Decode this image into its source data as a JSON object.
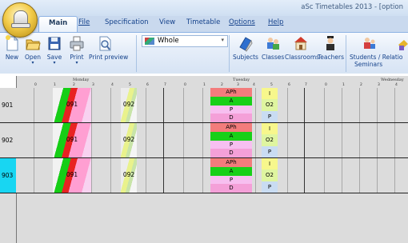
{
  "window": {
    "title": "aSc Timetables 2013 - [option"
  },
  "menu_tabs": [
    {
      "label": "Main",
      "active": true
    },
    {
      "label": "File",
      "active": false,
      "underline": "F"
    },
    {
      "label": "Specification",
      "active": false
    },
    {
      "label": "View",
      "active": false
    },
    {
      "label": "Timetable",
      "active": false
    },
    {
      "label": "Options",
      "active": false,
      "underline": "O"
    },
    {
      "label": "Help",
      "active": false,
      "underline": "H"
    }
  ],
  "ribbon": {
    "buttons": [
      {
        "label": "New",
        "icon": "new-document-icon"
      },
      {
        "label": "Open",
        "icon": "open-folder-icon",
        "dropdown": true
      },
      {
        "label": "Save",
        "icon": "save-disk-icon",
        "dropdown": true
      },
      {
        "label": "Print",
        "icon": "printer-icon",
        "dropdown": true
      },
      {
        "label": "Print preview",
        "icon": "print-preview-icon"
      },
      {
        "label": "Subjects",
        "icon": "subjects-book-icon"
      },
      {
        "label": "Classes",
        "icon": "classes-people-icon"
      },
      {
        "label": "Classrooms",
        "icon": "classroom-house-icon"
      },
      {
        "label": "Teachers",
        "icon": "teacher-icon"
      },
      {
        "label": "Students / Relatio",
        "icon": "students-icon"
      },
      {
        "label": "Seminars",
        "icon": "seminars-icon"
      }
    ],
    "combo": {
      "value": "Whole",
      "icon": "whole-school-icon"
    }
  },
  "grid": {
    "days": [
      "Monday",
      "Tuesday",
      "Wednesday"
    ],
    "periods": [
      "0",
      "1",
      "2",
      "3",
      "4",
      "5",
      "6",
      "7"
    ],
    "rows": [
      {
        "class": "901",
        "selected": false,
        "cards": [
          "091",
          "092"
        ],
        "tue_stack": [
          "APh",
          "A",
          "P",
          "D"
        ],
        "tue_right": [
          "I",
          "O2",
          "P"
        ]
      },
      {
        "class": "902",
        "selected": false,
        "cards": [
          "091",
          "092"
        ],
        "tue_stack": [
          "APh",
          "A",
          "P",
          "D"
        ],
        "tue_right": [
          "I",
          "O2",
          "P"
        ]
      },
      {
        "class": "903",
        "selected": true,
        "cards": [
          "091",
          "092"
        ],
        "tue_stack": [
          "APh",
          "A",
          "P",
          "D"
        ],
        "tue_right": [
          "I",
          "O2",
          "P"
        ]
      }
    ]
  },
  "colors": {
    "aph": "#f37c7c",
    "a": "#18d018",
    "p": "#f7bff0",
    "d": "#f4a0d8",
    "i": "#f7f78c",
    "o2": "#dff5a0",
    "p_right": "#c9dcf2",
    "selected_row": "#18d6f2"
  }
}
